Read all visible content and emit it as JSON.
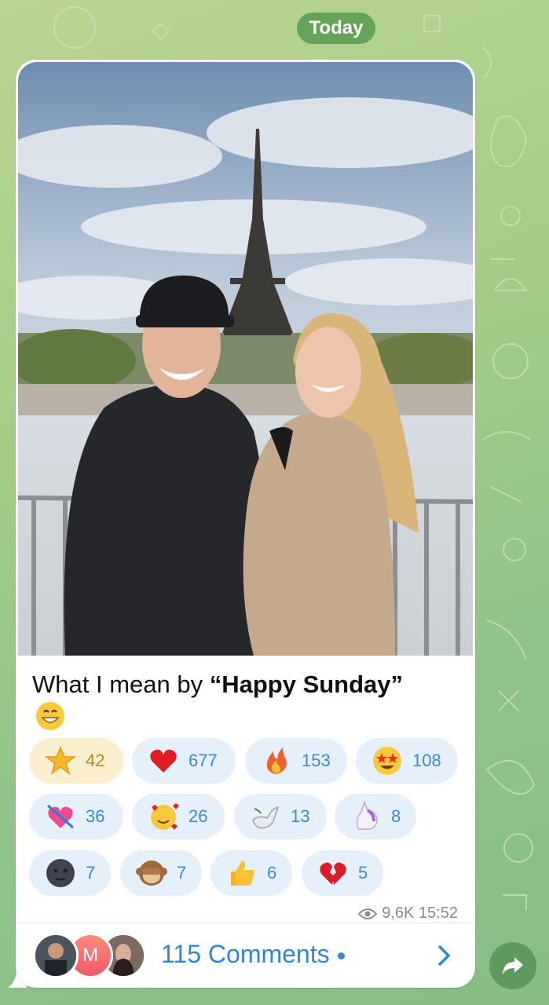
{
  "date_pill": "Today",
  "caption": {
    "prefix": "What I mean by ",
    "bold": "“Happy Sunday”"
  },
  "caption_emoji": "grinning-face",
  "reactions": [
    {
      "emoji": "star",
      "count": "42",
      "paid": true
    },
    {
      "emoji": "red-heart",
      "count": "677"
    },
    {
      "emoji": "fire",
      "count": "153"
    },
    {
      "emoji": "star-struck",
      "count": "108"
    },
    {
      "emoji": "heart-with-arrow",
      "count": "36"
    },
    {
      "emoji": "smiling-face-with-hearts",
      "count": "26"
    },
    {
      "emoji": "dove",
      "count": "13"
    },
    {
      "emoji": "unicorn",
      "count": "8"
    },
    {
      "emoji": "new-moon-face",
      "count": "7"
    },
    {
      "emoji": "see-no-evil-monkey",
      "count": "7"
    },
    {
      "emoji": "thumbs-up",
      "count": "6"
    },
    {
      "emoji": "broken-heart",
      "count": "5"
    }
  ],
  "meta": {
    "views": "9,6K",
    "time": "15:52"
  },
  "comments": {
    "label": "115 Comments",
    "avatar_letter": "M"
  },
  "colors": {
    "accent": "#2f87d8",
    "reaction_bg": "#e5f0fb",
    "paid_bg": "#fbefcf",
    "date_pill": "#67a25a",
    "share_button": "#5e9a5f"
  }
}
